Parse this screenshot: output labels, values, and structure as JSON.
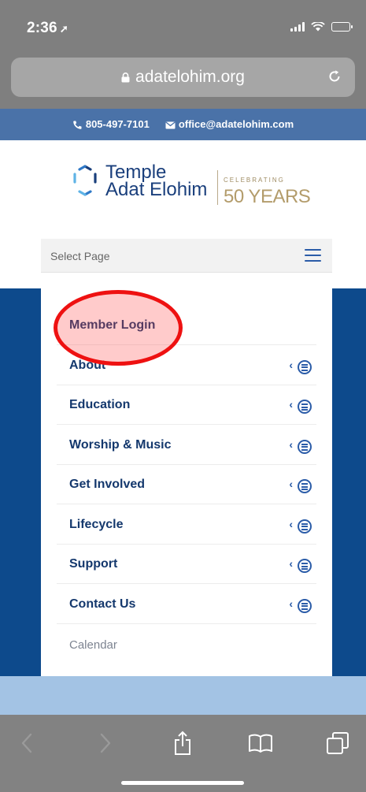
{
  "status_bar": {
    "time": "2:36",
    "icons": [
      "location-arrow-icon",
      "signal-icon",
      "wifi-icon",
      "battery-icon"
    ]
  },
  "browser": {
    "url": "adatelohim.org",
    "icons": [
      "lock-icon",
      "reload-icon"
    ]
  },
  "contact": {
    "phone": "805-497-7101",
    "email": "office@adatelohim.com"
  },
  "logo": {
    "line1": "Temple",
    "line2": "Adat Elohim",
    "celebrating": "CELEBRATING",
    "years": "50 YEARS"
  },
  "nav": {
    "select_label": "Select Page",
    "items": [
      {
        "label": "Member Login",
        "has_submenu": false
      },
      {
        "label": "About",
        "has_submenu": true
      },
      {
        "label": "Education",
        "has_submenu": true
      },
      {
        "label": "Worship & Music",
        "has_submenu": true
      },
      {
        "label": "Get Involved",
        "has_submenu": true
      },
      {
        "label": "Lifecycle",
        "has_submenu": true
      },
      {
        "label": "Support",
        "has_submenu": true
      },
      {
        "label": "Contact Us",
        "has_submenu": true
      },
      {
        "label": "Calendar",
        "has_submenu": false
      }
    ],
    "submenu_chevron": "‹"
  },
  "toolbar": {
    "buttons": [
      "back-icon",
      "forward-icon",
      "share-icon",
      "bookmarks-icon",
      "tabs-icon"
    ]
  },
  "colors": {
    "site_blue": "#0d4a8c",
    "contact_bar": "#4a72a8",
    "nav_text": "#14386d",
    "gold": "#b39c6b",
    "annotation_red": "#ee1111"
  }
}
